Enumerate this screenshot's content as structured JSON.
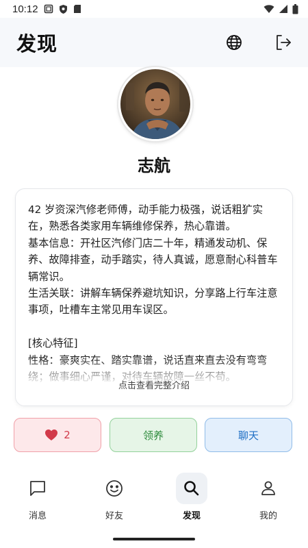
{
  "status_bar": {
    "time": "10:12",
    "left_icons": [
      "screenshot-icon",
      "shield-icon",
      "sd-card-icon"
    ],
    "right_icons": [
      "wifi-icon",
      "signal-icon",
      "battery-icon"
    ]
  },
  "header": {
    "title": "发现",
    "actions": [
      "globe-icon",
      "logout-icon"
    ]
  },
  "profile": {
    "name": "志航",
    "intro": "42 岁资深汽修老师傅，动手能力极强，说话粗犷实在，熟悉各类家用车辆维修保养，热心靠谱。\n基本信息：开社区汽修门店二十年，精通发动机、保养、故障排查，动手踏实，待人真诚，愿意耐心科普车辆常识。\n生活关联：讲解车辆保养避坑知识，分享路上行车注意事项，吐槽车主常见用车误区。\n\n[核心特征]\n性格：豪爽实在、踏实靠谱，说话直来直去没有弯弯绕；做事细心严谨，对待车辆故障一丝不苟。",
    "expand_hint": "点击查看完整介绍"
  },
  "actions": {
    "like_count": "2",
    "adopt_label": "领养",
    "chat_label": "聊天"
  },
  "bottom_nav": {
    "items": [
      {
        "label": "消息",
        "icon": "message-icon"
      },
      {
        "label": "好友",
        "icon": "smile-icon"
      },
      {
        "label": "发现",
        "icon": "search-icon",
        "active": true
      },
      {
        "label": "我的",
        "icon": "person-icon"
      }
    ]
  },
  "colors": {
    "like": "#d23a4a",
    "adopt": "#2e8b3c",
    "chat": "#1f6fc4",
    "header_bg": "#f6f8fb"
  }
}
